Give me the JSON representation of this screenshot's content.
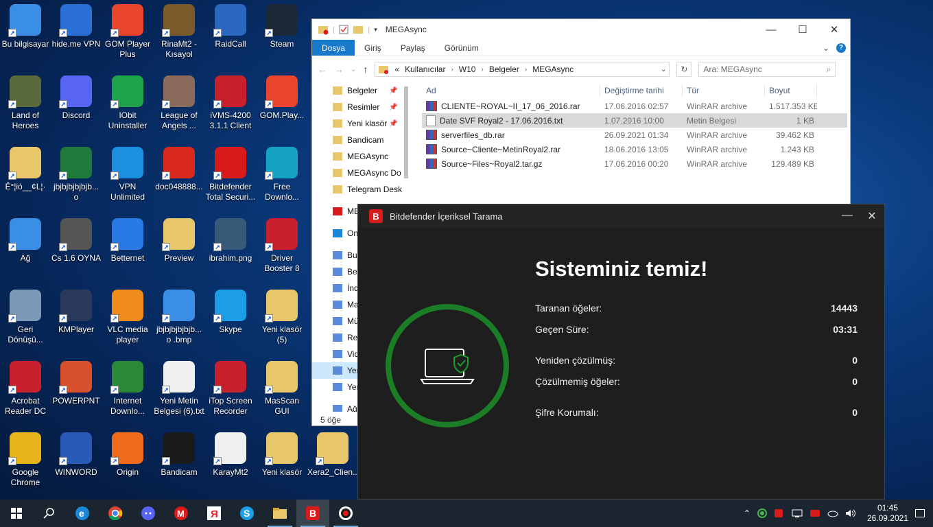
{
  "desktop": {
    "icons": [
      {
        "label": "Bu bilgisayar",
        "color": "#3a8ee6"
      },
      {
        "label": "hide.me VPN",
        "color": "#2a6fd6"
      },
      {
        "label": "GOM Player Plus",
        "color": "#e8452c"
      },
      {
        "label": "RinaMt2 - Kısayol",
        "color": "#7a5a2a"
      },
      {
        "label": "RaidCall",
        "color": "#2a68c0"
      },
      {
        "label": "Steam",
        "color": "#1b2838"
      },
      {
        "label": "Land of Heroes",
        "color": "#5a6a3a"
      },
      {
        "label": "Discord",
        "color": "#5865f2"
      },
      {
        "label": "IObit Uninstaller",
        "color": "#1ea34a"
      },
      {
        "label": "League of Angels ...",
        "color": "#8a6a5a"
      },
      {
        "label": "iVMS-4200 3.1.1 Client",
        "color": "#c8202c"
      },
      {
        "label": "GOM.Play...",
        "color": "#e8452c"
      },
      {
        "label": "Ê°¦ió__¢L¦·",
        "color": "#e8c66a"
      },
      {
        "label": "jbjbjbjbjbjb... o",
        "color": "#1e7a3a"
      },
      {
        "label": "VPN Unlimited",
        "color": "#1c8fe0"
      },
      {
        "label": "doc048888...",
        "color": "#d9291c"
      },
      {
        "label": "Bitdefender Total Securi...",
        "color": "#d81c1c"
      },
      {
        "label": "Free Downlo...",
        "color": "#16a3c2"
      },
      {
        "label": "Ağ",
        "color": "#3a8ee6"
      },
      {
        "label": "Cs 1.6 OYNA",
        "color": "#555555"
      },
      {
        "label": "Betternet",
        "color": "#2a7ae6"
      },
      {
        "label": "Preview",
        "color": "#e8c66a"
      },
      {
        "label": "ibrahim.png",
        "color": "#3a5a7a"
      },
      {
        "label": "Driver Booster 8",
        "color": "#c8202c"
      },
      {
        "label": "Geri Dönüşü...",
        "color": "#7a9ab8"
      },
      {
        "label": "KMPlayer",
        "color": "#2a3a5a"
      },
      {
        "label": "VLC media player",
        "color": "#f08c1c"
      },
      {
        "label": "jbjbjbjbjbjb... o .bmp",
        "color": "#3a8ee6"
      },
      {
        "label": "Skype",
        "color": "#1c9ee6"
      },
      {
        "label": "Yeni klasör (5)",
        "color": "#e8c66a"
      },
      {
        "label": "Acrobat Reader DC",
        "color": "#c8202c"
      },
      {
        "label": "POWERPNT",
        "color": "#d8502c"
      },
      {
        "label": "Internet Downlo...",
        "color": "#2a8a3a"
      },
      {
        "label": "Yeni Metin Belgesi (6).txt",
        "color": "#f0f0f0"
      },
      {
        "label": "iTop Screen Recorder",
        "color": "#c8202c"
      },
      {
        "label": "MasScan GUI",
        "color": "#e8c66a"
      },
      {
        "label": "Google Chrome",
        "color": "#e8b41c"
      },
      {
        "label": "WINWORD",
        "color": "#2a5ab8"
      },
      {
        "label": "Origin",
        "color": "#f06a1c"
      },
      {
        "label": "Bandicam",
        "color": "#1a1a1a"
      },
      {
        "label": "KarayMt2",
        "color": "#f0f0f0"
      },
      {
        "label": "Yeni klasör",
        "color": "#e8c66a"
      },
      {
        "label": "Xera2_Clien...",
        "color": "#e8c66a"
      }
    ]
  },
  "explorer": {
    "title": "MEGAsync",
    "ribbon_tabs": [
      "Dosya",
      "Giriş",
      "Paylaş",
      "Görünüm"
    ],
    "address": {
      "prefix": "«",
      "segments": [
        "Kullanıcılar",
        "W10",
        "Belgeler",
        "MEGAsync"
      ]
    },
    "search_placeholder": "Ara: MEGAsync",
    "nav_items": [
      {
        "label": "Belgeler",
        "pinned": true
      },
      {
        "label": "Resimler",
        "pinned": true
      },
      {
        "label": "Yeni klasör",
        "pinned": true
      },
      {
        "label": "Bandicam",
        "pinned": false
      },
      {
        "label": "MEGAsync",
        "pinned": false
      },
      {
        "label": "MEGAsync Do",
        "pinned": false
      },
      {
        "label": "Telegram Desk",
        "pinned": false
      },
      {
        "label": "MEG",
        "pinned": false
      },
      {
        "label": "One",
        "pinned": false
      },
      {
        "label": "Bu b",
        "pinned": false
      },
      {
        "label": "Be",
        "pinned": false
      },
      {
        "label": "İnd",
        "pinned": false
      },
      {
        "label": "Ma",
        "pinned": false
      },
      {
        "label": "Mü",
        "pinned": false
      },
      {
        "label": "Re",
        "pinned": false
      },
      {
        "label": "Vid",
        "pinned": false
      },
      {
        "label": "Yer",
        "pinned": false
      },
      {
        "label": "Yer",
        "pinned": false
      },
      {
        "label": "Ağ",
        "pinned": false
      }
    ],
    "columns": [
      "Ad",
      "Değiştirme tarihi",
      "Tür",
      "Boyut"
    ],
    "files": [
      {
        "name": "CLIENTE~ROYAL~II_17_06_2016.rar",
        "date": "17.06.2016 02:57",
        "type": "WinRAR archive",
        "size": "1.517.353 KB",
        "icon": "rar"
      },
      {
        "name": "Date SVF Royal2 - 17.06.2016.txt",
        "date": "1.07.2016 10:00",
        "type": "Metin Belgesi",
        "size": "1 KB",
        "icon": "txt"
      },
      {
        "name": "serverfiles_db.rar",
        "date": "26.09.2021 01:34",
        "type": "WinRAR archive",
        "size": "39.462 KB",
        "icon": "rar"
      },
      {
        "name": "Source~Cliente~MetinRoyal2.rar",
        "date": "18.06.2016 13:05",
        "type": "WinRAR archive",
        "size": "1.243 KB",
        "icon": "rar"
      },
      {
        "name": "Source~Files~Royal2.tar.gz",
        "date": "17.06.2016 00:20",
        "type": "WinRAR archive",
        "size": "129.489 KB",
        "icon": "rar"
      }
    ],
    "status": "5 öğe"
  },
  "bitdefender": {
    "title": "Bitdefender İçeriksel Tarama",
    "headline": "Sisteminiz temiz!",
    "stats": [
      {
        "label": "Taranan öğeler:",
        "value": "14443"
      },
      {
        "label": "Geçen Süre:",
        "value": "03:31"
      },
      {
        "label": "Yeniden çözülmüş:",
        "value": "0"
      },
      {
        "label": "Çözülmemiş öğeler:",
        "value": "0"
      },
      {
        "label": "Şifre Korumalı:",
        "value": "0"
      }
    ],
    "accent_color": "#1b7d25"
  },
  "taskbar": {
    "apps": [
      "start-icon",
      "search-icon",
      "edge-icon",
      "chrome-icon",
      "discord-icon",
      "mega-icon",
      "yandex-icon",
      "skype-icon",
      "file-explorer-icon",
      "bitdefender-icon",
      "bandicam-icon"
    ],
    "time": "01:45",
    "date": "26.09.2021"
  }
}
